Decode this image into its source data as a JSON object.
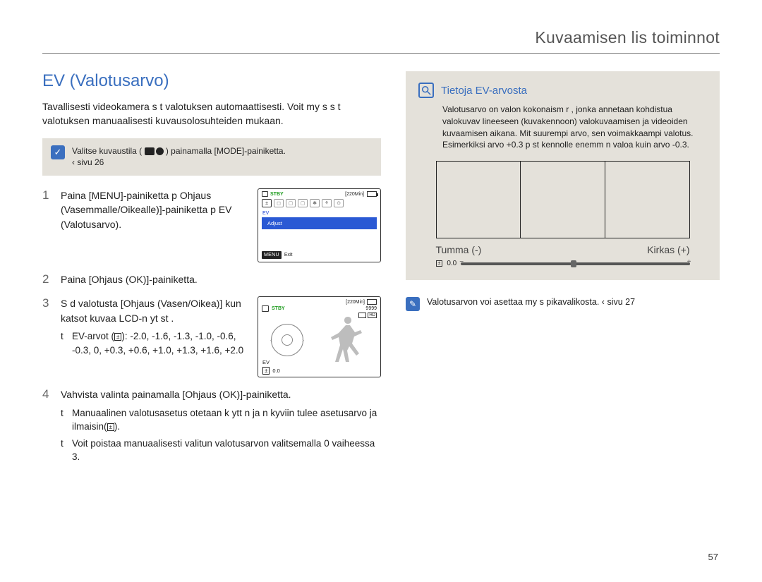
{
  "header": {
    "chapter": "Kuvaamisen lis toiminnot"
  },
  "section": {
    "title": "EV (Valotusarvo)"
  },
  "intro": "Tavallisesti videokamera s t  valotuksen automaattisesti. Voit my s s t  valotuksen manuaalisesti kuvausolosuhteiden mukaan.",
  "mode_note": {
    "prefix": "Valitse kuvaustila (",
    "suffix": ") painamalla [MODE]-painiketta.",
    "ref": "‹ sivu 26"
  },
  "steps": [
    {
      "num": "1",
      "text": "Paina [MENU]-painiketta p Ohjaus (Vasemmalle/Oikealle)]-painiketta p EV (Valotusarvo)."
    },
    {
      "num": "2",
      "text": "Paina [Ohjaus (OK)]-painiketta."
    },
    {
      "num": "3",
      "text": "S d  valotusta [Ohjaus (Vasen/Oikea)] kun katsot kuvaa LCD-n yt st .",
      "bullets": [
        {
          "label": "EV-arvot (",
          "icon": "±",
          "after": "): -2.0, -1.6, -1.3, -1.0, -0.6, -0.3, 0, +0.3, +0.6, +1.0, +1.3, +1.6, +2.0"
        }
      ]
    },
    {
      "num": "4",
      "text": "Vahvista valinta painamalla [Ohjaus (OK)]-painiketta.",
      "bullets": [
        {
          "label": "",
          "after": "Manuaalinen valotusasetus otetaan k ytt n ja n kyviin tulee asetusarvo ja ilmaisin(      )."
        },
        {
          "label": "",
          "after": "Voit poistaa manuaalisesti valitun valotusarvon valitsemalla 0 vaiheessa 3."
        }
      ]
    }
  ],
  "fig1": {
    "stby": "STBY",
    "time": "[220Min]",
    "ev_label": "EV",
    "adjust": "Adjust",
    "menu_label": "MENU",
    "exit": "Exit"
  },
  "fig2": {
    "stby": "STBY",
    "time": "[220Min]",
    "count": "9999",
    "hd": "HD",
    "ev_label": "EV",
    "ev_value": "0.0"
  },
  "info": {
    "title": "Tietoja EV-arvosta",
    "body": "Valotusarvo on valon kokonaism r , jonka annetaan kohdistua valokuvav lineeseen (kuvakennoon) valokuvaamisen ja videoiden kuvaamisen aikana. Mit  suurempi arvo, sen voimakkaampi valotus. Esimerkiksi arvo +0.3 p st  kennolle enemm n valoa kuin arvo -0.3.",
    "dark": "Tumma (-)",
    "bright": "Kirkas (+)",
    "bar_value": "0.0"
  },
  "footnote": "Valotusarvon voi asettaa my s pikavalikosta. ‹ sivu 27",
  "page_number": "57"
}
